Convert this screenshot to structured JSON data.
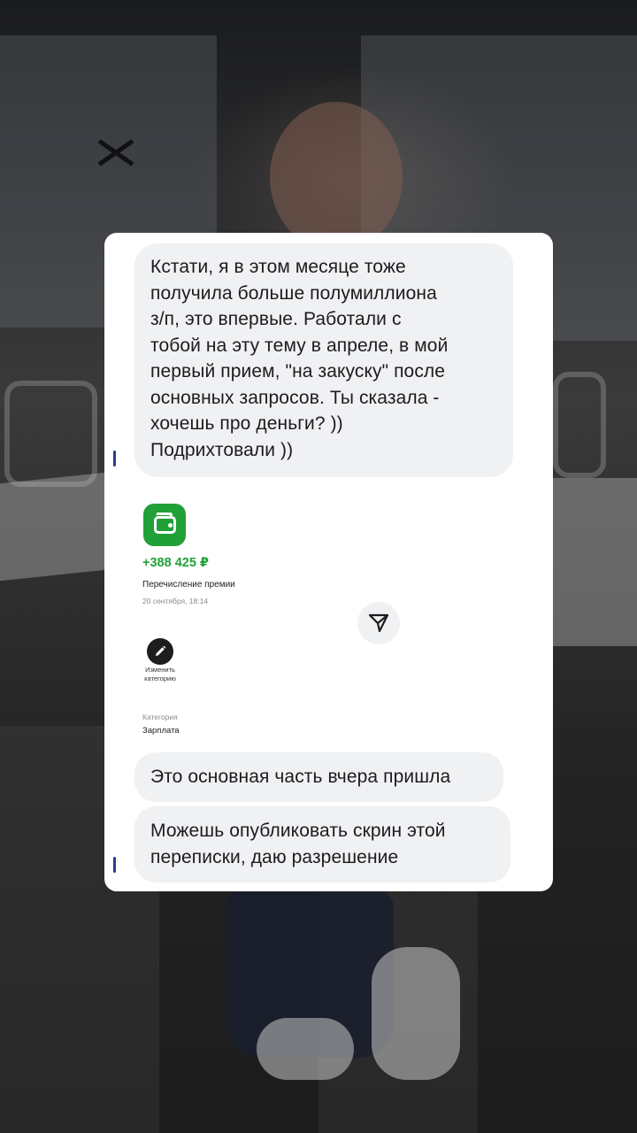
{
  "messages": {
    "first": "Кстати, я в этом месяце тоже\nполучила больше полумиллиона\nз/п, это впервые. Работали с\nтобой на эту тему в апреле, в мой\nпервый прием, \"на закуску\" после\nосновных запросов. Ты сказала -\nхочешь про деньги? ))\nПодрихтовали ))",
    "second": "Это основная часть вчера пришла",
    "third": "Можешь опубликовать скрин этой\nпереписки, даю разрешение"
  },
  "transaction": {
    "amount": "+388 425 ₽",
    "description": "Перечисление премии",
    "date": "20 сентября, 18:14",
    "edit_label": "Изменить\nкатегорию",
    "category_label": "Категория",
    "category_value": "Зарплата",
    "icons": {
      "wallet": "wallet-icon",
      "send": "send-icon",
      "edit": "pencil-icon"
    }
  },
  "colors": {
    "accent_green": "#21a038",
    "bubble_bg": "#f0f1f3"
  }
}
